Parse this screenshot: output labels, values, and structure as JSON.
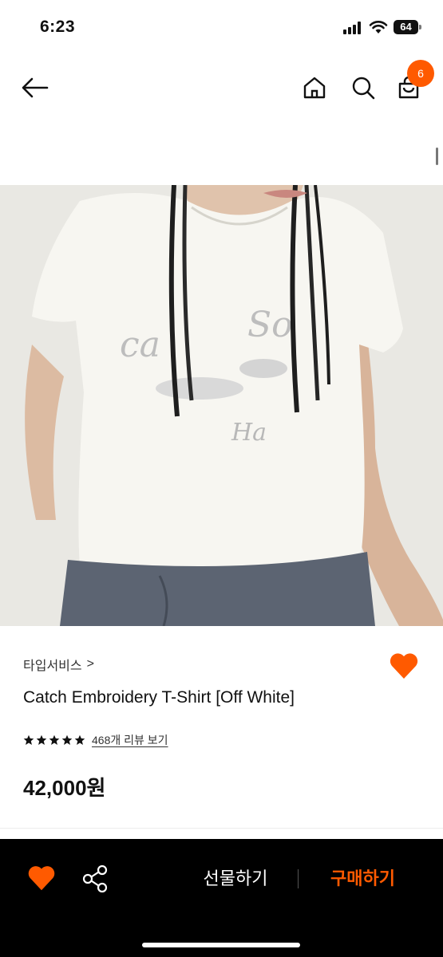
{
  "status_bar": {
    "time": "6:23",
    "battery_level": "64"
  },
  "top_nav": {
    "icons": [
      "back-arrow-icon",
      "home-icon",
      "search-icon",
      "cart-icon"
    ],
    "cart_count": "6",
    "badge_color": "#ff5a00"
  },
  "product": {
    "brand": "타입서비스",
    "brand_chevron": ">",
    "title": "Catch Embroidery T-Shirt [Off White]",
    "rating_stars": 5,
    "review_link": "468개 리뷰 보기",
    "price": "42,000원",
    "wishlisted": true
  },
  "bottom_bar": {
    "gift_label": "선물하기",
    "buy_label": "구매하기",
    "accent": "#ff5a00",
    "icons": [
      "heart-icon",
      "share-icon"
    ]
  },
  "colors": {
    "accent": "#ff5a00",
    "bottom_bar_bg": "#000000"
  }
}
